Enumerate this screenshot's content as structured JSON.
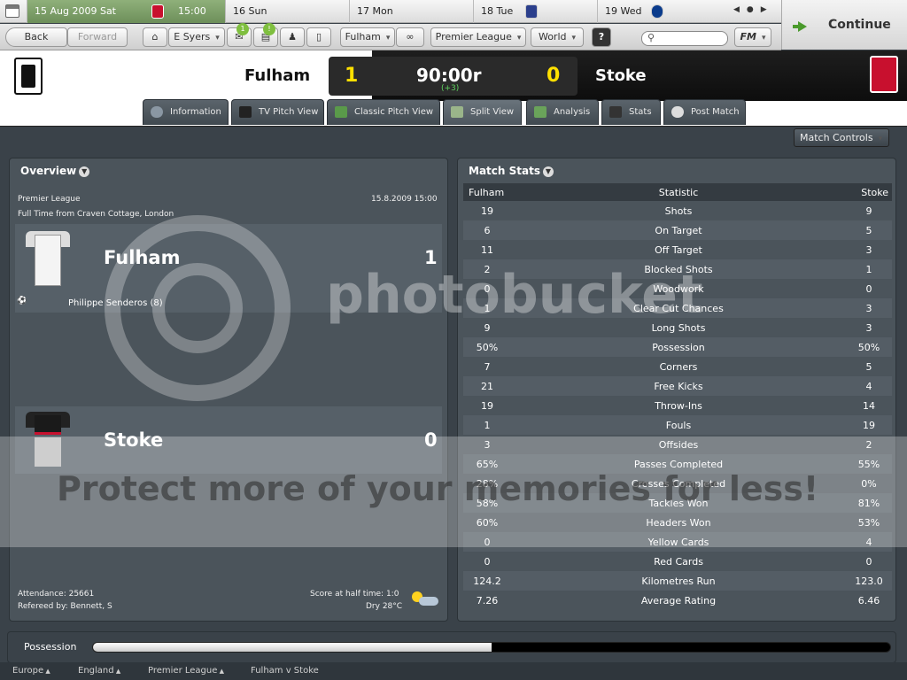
{
  "calendar": {
    "active_day": "15 Aug 2009  Sat",
    "active_time": "15:00",
    "days": [
      "16 Sun",
      "17 Mon",
      "18 Tue",
      "19 Wed"
    ]
  },
  "continue_label": "Continue",
  "toolbar": {
    "back": "Back",
    "forward": "Forward",
    "manager": "E Syers",
    "badge1": "1",
    "badge2": "!",
    "club": "Fulham",
    "competition": "Premier League",
    "world": "World",
    "help": "?",
    "fm": "FM"
  },
  "match": {
    "home": "Fulham",
    "away": "Stoke",
    "home_score": "1",
    "away_score": "0",
    "clock": "90:00r",
    "added": "(+3)"
  },
  "tabs": [
    "Information",
    "TV Pitch View",
    "Classic Pitch View",
    "Split View",
    "Analysis",
    "Stats",
    "Post Match"
  ],
  "match_controls": "Match Controls",
  "overview": {
    "title": "Overview",
    "competition": "Premier League",
    "datetime": "15.8.2009 15:00",
    "venue": "Full Time from Craven Cottage, London",
    "home": "Fulham",
    "home_score": "1",
    "scorer": "Philippe Senderos (8)",
    "away": "Stoke",
    "away_score": "0",
    "attendance": "Attendance: 25661",
    "referee": "Refereed by: Bennett, S",
    "halftime": "Score at half time: 1:0",
    "weather": "Dry 28°C"
  },
  "stats": {
    "title": "Match Stats",
    "headers": [
      "Fulham",
      "Statistic",
      "Stoke"
    ],
    "rows": [
      [
        "19",
        "Shots",
        "9"
      ],
      [
        "6",
        "On Target",
        "5"
      ],
      [
        "11",
        "Off Target",
        "3"
      ],
      [
        "2",
        "Blocked Shots",
        "1"
      ],
      [
        "0",
        "Woodwork",
        "0"
      ],
      [
        "1",
        "Clear Cut Chances",
        "3"
      ],
      [
        "9",
        "Long Shots",
        "3"
      ],
      [
        "50%",
        "Possession",
        "50%"
      ],
      [
        "7",
        "Corners",
        "5"
      ],
      [
        "21",
        "Free Kicks",
        "4"
      ],
      [
        "19",
        "Throw-Ins",
        "14"
      ],
      [
        "1",
        "Fouls",
        "19"
      ],
      [
        "3",
        "Offsides",
        "2"
      ],
      [
        "65%",
        "Passes Completed",
        "55%"
      ],
      [
        "28%",
        "Crosses Completed",
        "0%"
      ],
      [
        "58%",
        "Tackles Won",
        "81%"
      ],
      [
        "60%",
        "Headers Won",
        "53%"
      ],
      [
        "0",
        "Yellow Cards",
        "4"
      ],
      [
        "0",
        "Red Cards",
        "0"
      ],
      [
        "124.2",
        "Kilometres Run",
        "123.0"
      ],
      [
        "7.26",
        "Average Rating",
        "6.46"
      ]
    ]
  },
  "possession": {
    "label": "Possession",
    "home_fraction": 0.5
  },
  "breadcrumbs": [
    "Europe",
    "England",
    "Premier League",
    "Fulham v Stoke"
  ],
  "watermark": {
    "brand": "photobucket",
    "slogan": "Protect more of your memories for less!"
  },
  "colors": {
    "score": "#ffe000",
    "accent_green": "#4a9a2c"
  }
}
